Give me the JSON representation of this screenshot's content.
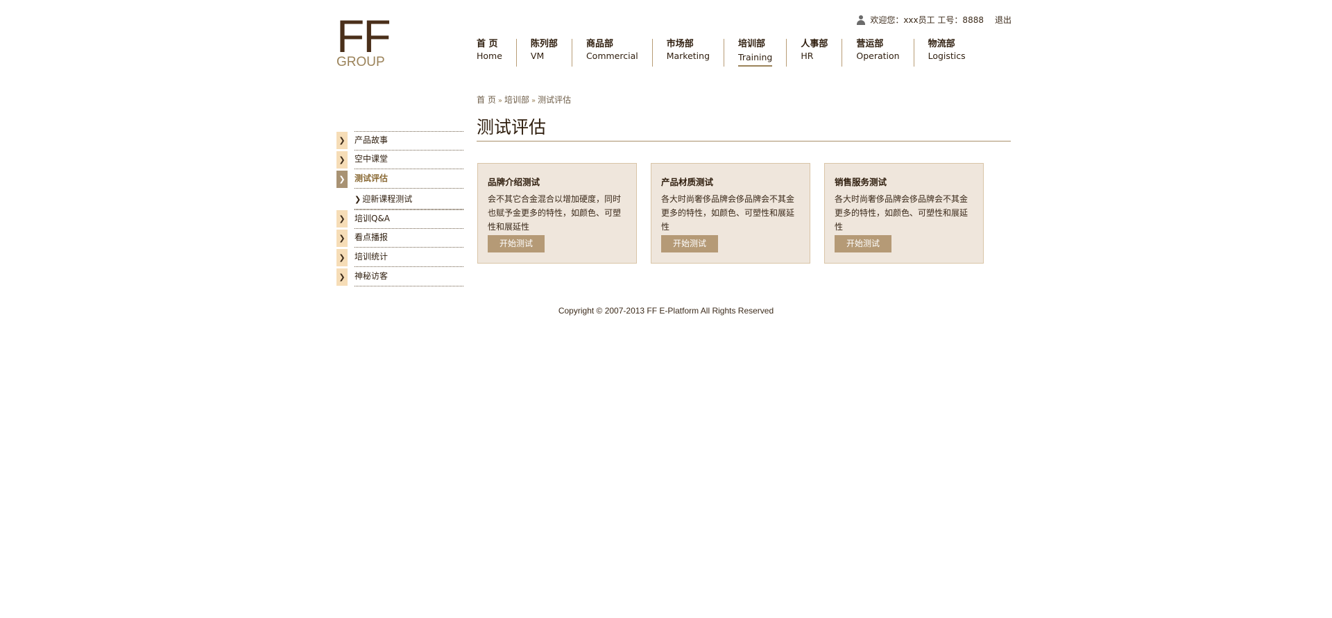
{
  "brand": {
    "logo_main": "FF",
    "logo_sub": "GROUP"
  },
  "userbar": {
    "icon": "user-icon",
    "welcome": "欢迎您：xxx员工 工号：8888",
    "logout": "退出"
  },
  "nav": [
    {
      "cn": "首 页",
      "en": "Home"
    },
    {
      "cn": "陈列部",
      "en": "VM"
    },
    {
      "cn": "商品部",
      "en": "Commercial"
    },
    {
      "cn": "市场部",
      "en": "Marketing"
    },
    {
      "cn": "培训部",
      "en": "Training",
      "active": true
    },
    {
      "cn": "人事部",
      "en": "HR"
    },
    {
      "cn": "营运部",
      "en": "Operation"
    },
    {
      "cn": "物流部",
      "en": "Logistics"
    }
  ],
  "breadcrumb": {
    "home": "首 页",
    "section": "培训部",
    "current": "测试评估",
    "sep": "»"
  },
  "page_title": "测试评估",
  "sidebar": {
    "marker": "❯",
    "items": [
      {
        "label": "产品故事"
      },
      {
        "label": "空中课堂"
      },
      {
        "label": "测试评估",
        "active": true
      },
      {
        "label": "迎新课程测试",
        "sub": true
      },
      {
        "label": "培训Q&A"
      },
      {
        "label": "看点播报"
      },
      {
        "label": "培训统计"
      },
      {
        "label": "神秘访客"
      }
    ]
  },
  "cards": [
    {
      "title": "品牌介绍测试",
      "desc": "会不其它合金混合以增加硬度，同时也赋予金更多的特性，如颜色、可塑性和展延性",
      "button": "开始测试"
    },
    {
      "title": "产品材质测试",
      "desc": "各大时尚奢侈品牌会侈品牌会不其金更多的特性，如颜色、可塑性和展延性",
      "button": "开始测试"
    },
    {
      "title": "销售服务测试",
      "desc": "各大时尚奢侈品牌会侈品牌会不其金更多的特性，如颜色、可塑性和展延性",
      "button": "开始测试"
    }
  ],
  "footer": "Copyright © 2007-2013 FF E-Platform All Rights Reserved",
  "colors": {
    "brand_dark": "#4a2f1a",
    "brand_gold": "#9b835a",
    "card_bg": "#efe6dc",
    "button": "#b59a76",
    "marker": "#f6ddb7"
  }
}
